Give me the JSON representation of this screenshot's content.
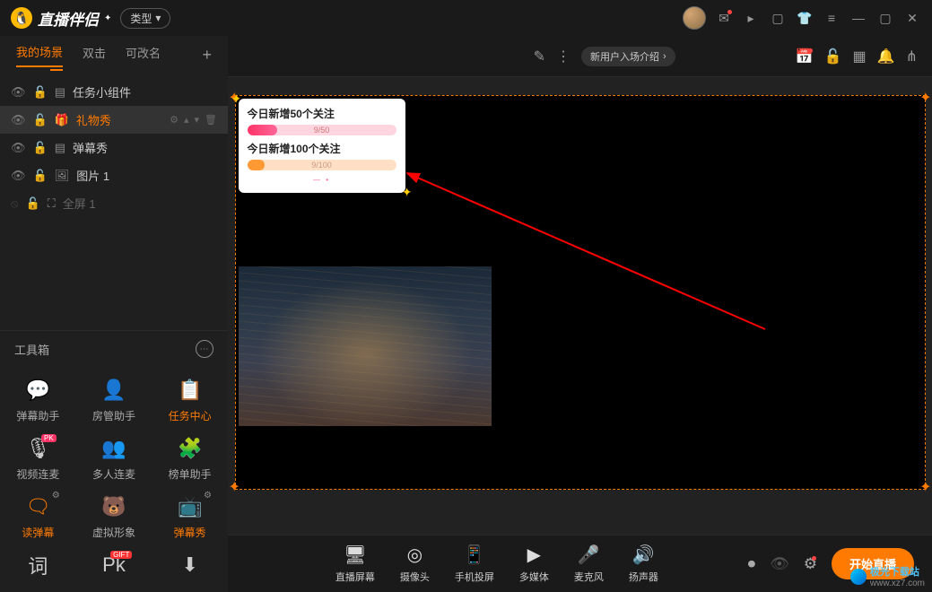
{
  "app": {
    "name": "直播伴侣",
    "type_button": "类型"
  },
  "tabs": [
    "我的场景",
    "双击",
    "可改名"
  ],
  "scenes": [
    {
      "icon": "task",
      "label": "任务小组件"
    },
    {
      "icon": "gift",
      "label": "礼物秀",
      "active": true
    },
    {
      "icon": "danmu",
      "label": "弹幕秀"
    },
    {
      "icon": "image",
      "label": "图片 1"
    },
    {
      "icon": "fullscreen",
      "label": "全屏 1",
      "dim": true
    }
  ],
  "toolbox": {
    "title": "工具箱",
    "tools": [
      {
        "label": "弹幕助手",
        "icon": "danmu-assist"
      },
      {
        "label": "房管助手",
        "icon": "room-assist"
      },
      {
        "label": "任务中心",
        "icon": "task-center",
        "active": true
      },
      {
        "label": "视频连麦",
        "icon": "video-link",
        "badge": "PK"
      },
      {
        "label": "多人连麦",
        "icon": "multi-link"
      },
      {
        "label": "榜单助手",
        "icon": "rank-assist"
      },
      {
        "label": "读弹幕",
        "icon": "read-danmu",
        "active": true,
        "gear": true
      },
      {
        "label": "虚拟形象",
        "icon": "virtual"
      },
      {
        "label": "弹幕秀",
        "icon": "danmu-show",
        "active": true,
        "gear": true
      },
      {
        "label": "词",
        "icon": "word",
        "partial": true
      },
      {
        "label": "PK",
        "icon": "pk",
        "badge": "GIFT",
        "partial": true
      },
      {
        "label": "下载",
        "icon": "download",
        "partial": true
      }
    ]
  },
  "content_toolbar": {
    "chip": "新用户入场介绍"
  },
  "widget": {
    "tasks": [
      {
        "title": "今日新增50个关注",
        "progress": "9/50"
      },
      {
        "title": "今日新增100个关注",
        "progress": "9/100"
      }
    ]
  },
  "sources": [
    {
      "label": "直播屏幕",
      "icon": "screen"
    },
    {
      "label": "摄像头",
      "icon": "camera"
    },
    {
      "label": "手机投屏",
      "icon": "phone"
    },
    {
      "label": "多媒体",
      "icon": "media"
    },
    {
      "label": "麦克风",
      "icon": "mic"
    },
    {
      "label": "扬声器",
      "icon": "speaker"
    }
  ],
  "start_button": "开始直播",
  "watermark": {
    "brand": "极光下载站",
    "url": "www.xz7.com"
  }
}
